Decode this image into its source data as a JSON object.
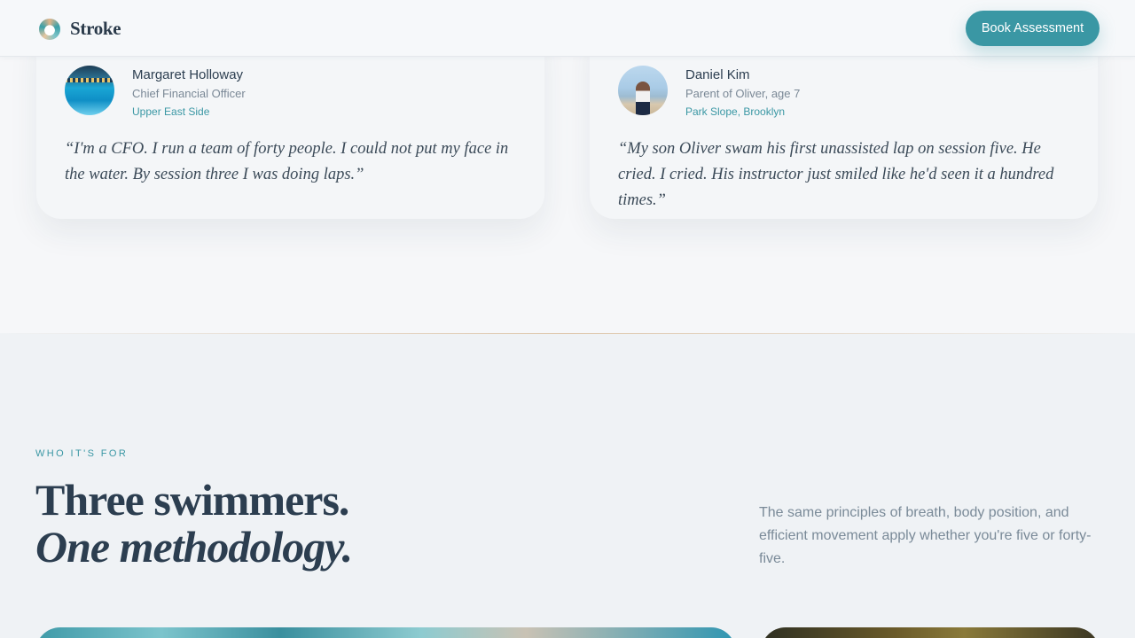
{
  "header": {
    "brand": "Stroke",
    "logo_icon": "swirl-logo-icon",
    "cta_label": "Book Assessment",
    "accent": "#3a97a4"
  },
  "testimonials": [
    {
      "name": "Margaret Holloway",
      "role": "Chief Financial Officer",
      "location": "Upper East Side",
      "quote": "“I'm a CFO. I run a team of forty people. I could not put my face in the water. By session three I was doing laps.”",
      "avatar": "pool-photo"
    },
    {
      "name": "Daniel Kim",
      "role": "Parent of Oliver, age 7",
      "location": "Park Slope, Brooklyn",
      "quote": "“My son Oliver swam his first unassisted lap on session five. He cried. I cried. His instructor just smiled like he'd seen it a hundred times.”",
      "avatar": "beach-child-photo"
    }
  ],
  "section": {
    "eyebrow": "WHO IT'S FOR",
    "headline_line1": "Three swimmers.",
    "headline_line2": "One methodology.",
    "lede": "The same principles of breath, body position, and efficient movement apply whether you're five or forty-five."
  }
}
